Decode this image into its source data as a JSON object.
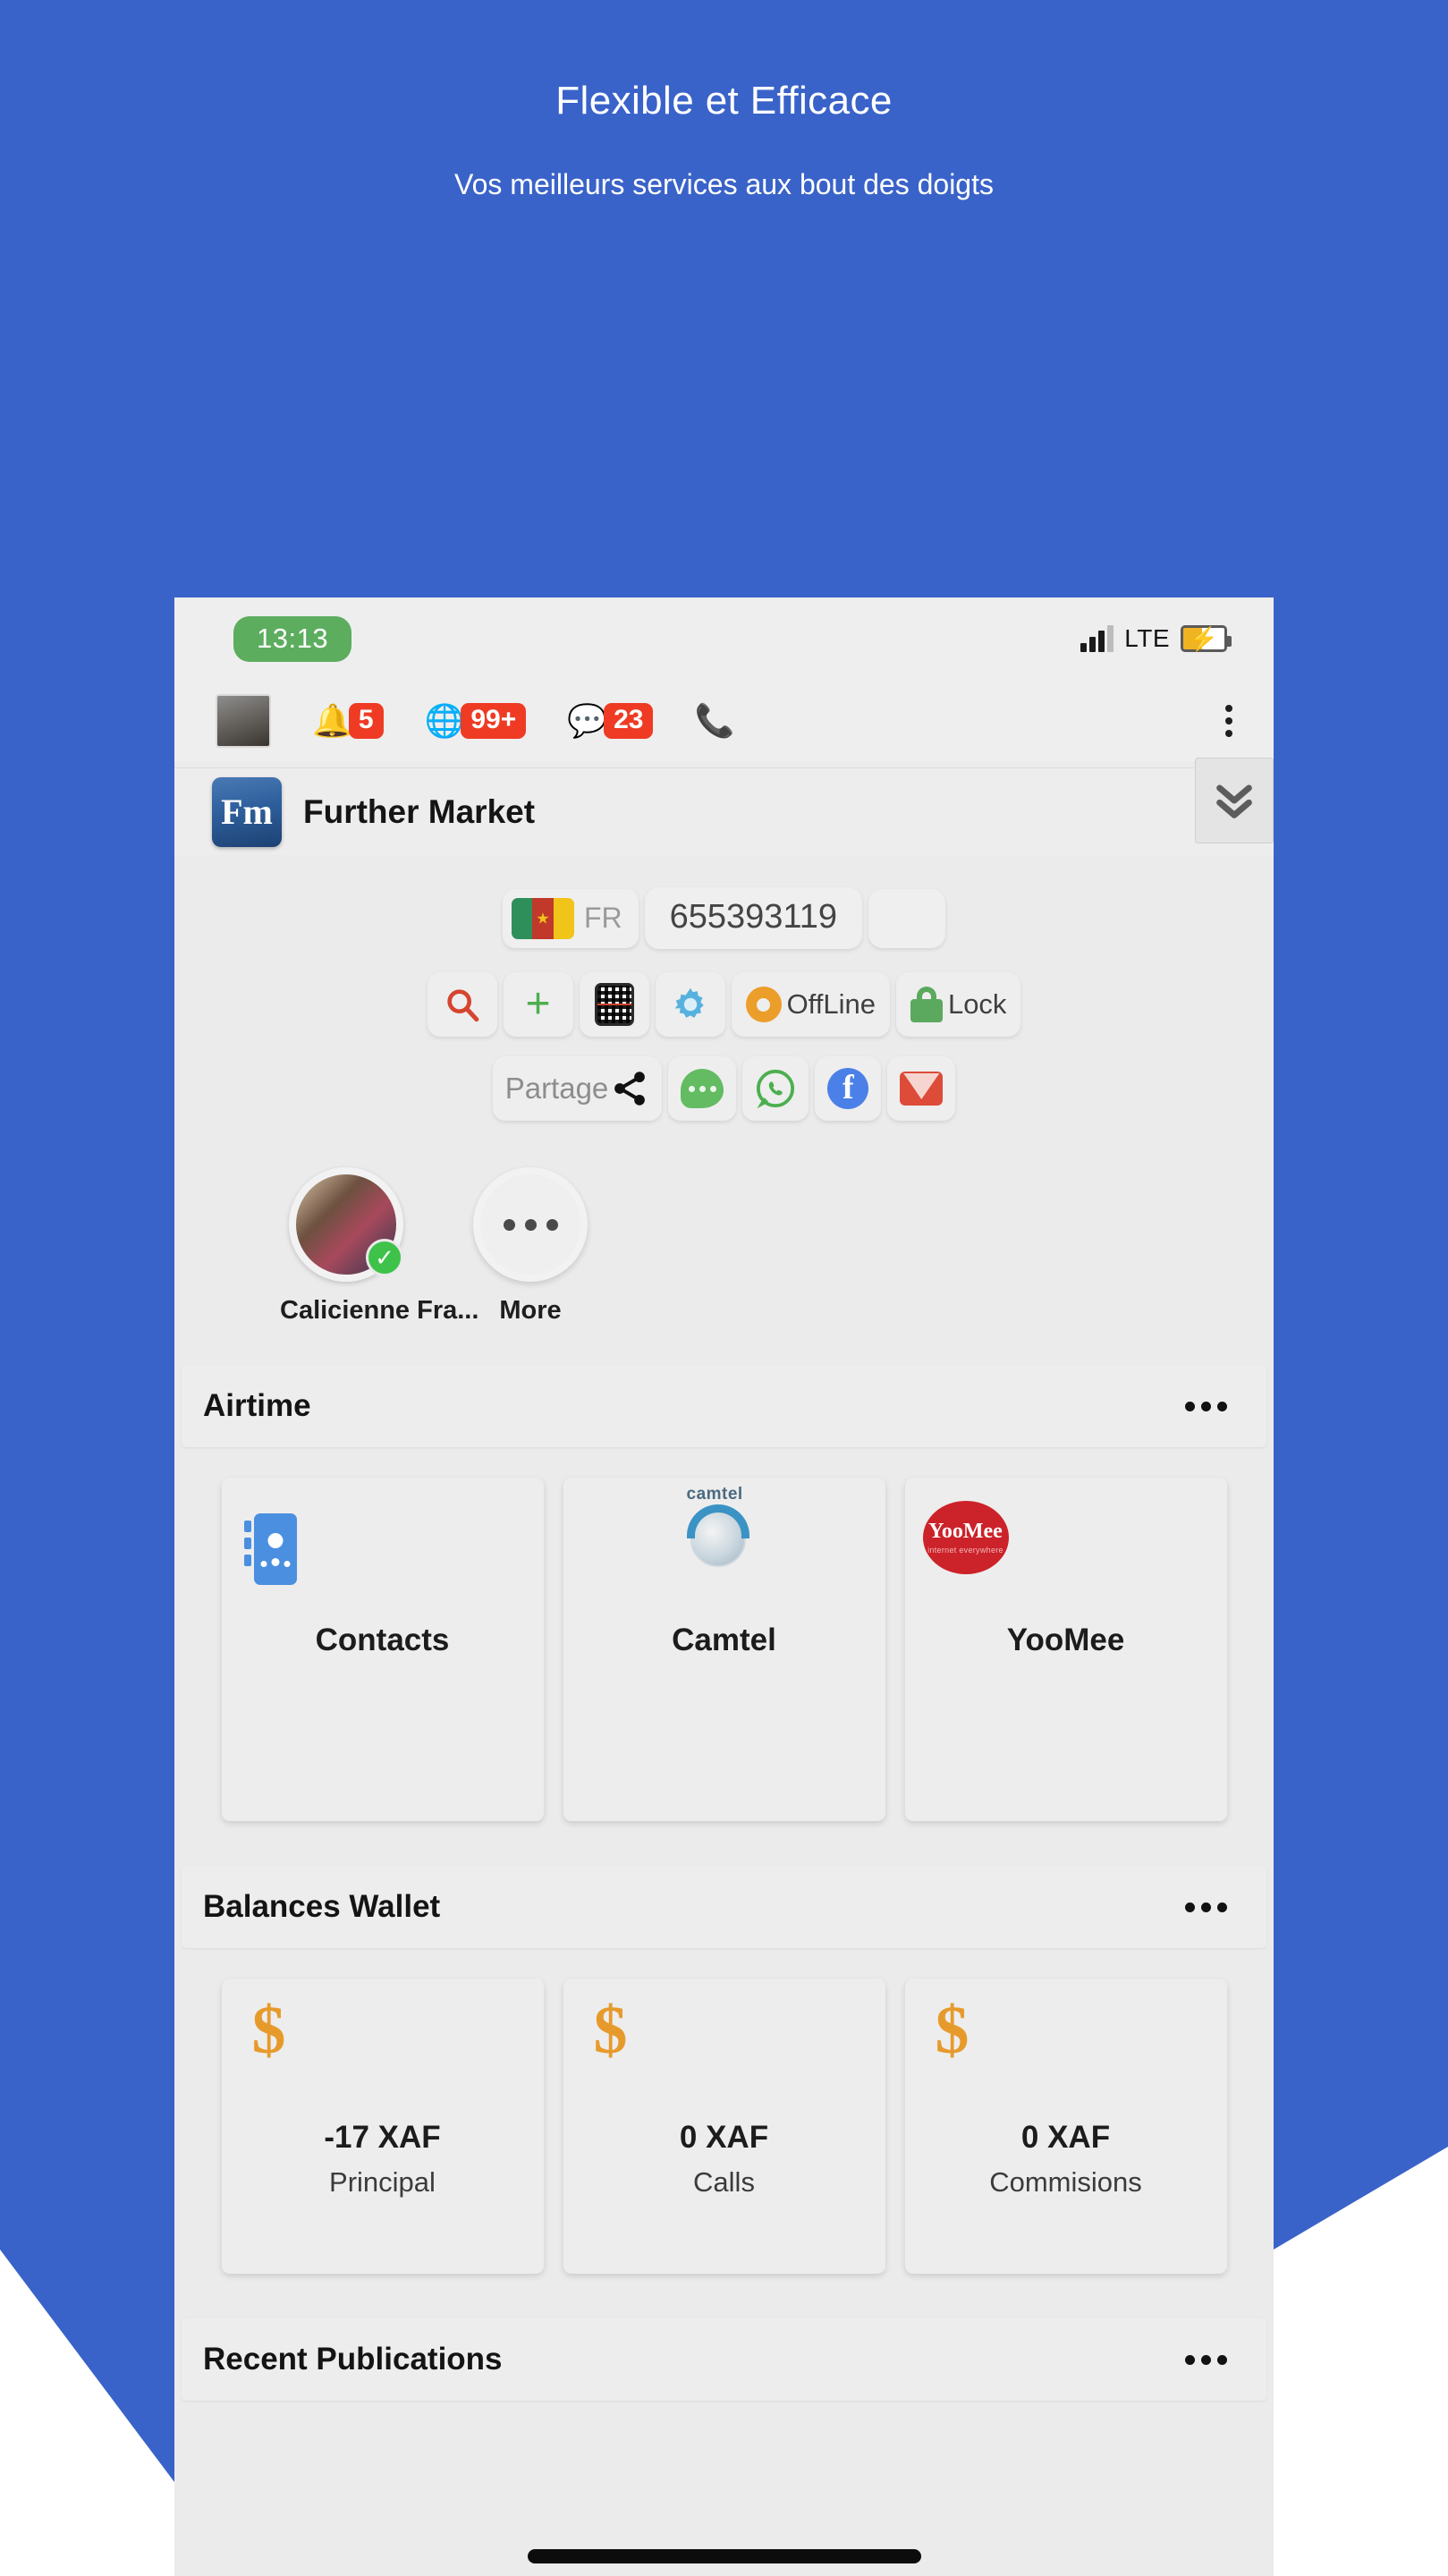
{
  "hero": {
    "title": "Flexible et Efficace",
    "subtitle": "Vos meilleurs services aux bout des doigts",
    "bg_color": "#3a63c9"
  },
  "statusbar": {
    "time": "13:13",
    "network": "LTE",
    "battery_state": "charging",
    "bolt": "⚡",
    "time_pill_color": "#5cad5e"
  },
  "notifications": {
    "avatar_label": "profile-photo",
    "items": [
      {
        "icon": "bell-icon",
        "glyph": "🔔",
        "count": "5"
      },
      {
        "icon": "globe-icon",
        "glyph": "🌐",
        "count": "99+"
      },
      {
        "icon": "chat-bubble-icon",
        "glyph": "💬",
        "count": "23"
      },
      {
        "icon": "phone-icon",
        "glyph": "📞",
        "count": ""
      }
    ],
    "badge_color": "#ef3b24",
    "overflow": "more-options"
  },
  "app_header": {
    "logo_text": "Fm",
    "name": "Further Market",
    "expand_icon": "double-chevron-down-icon"
  },
  "phone_row": {
    "country_code": "FR",
    "flag": "cameroon-flag",
    "number": "655393119",
    "extra_field": ""
  },
  "actions": [
    {
      "name": "search-button",
      "icon": "search-icon",
      "label": ""
    },
    {
      "name": "add-button",
      "icon": "plus-icon",
      "label": ""
    },
    {
      "name": "qr-scan-button",
      "icon": "qr-code-icon",
      "label": ""
    },
    {
      "name": "settings-button",
      "icon": "gear-icon",
      "label": ""
    },
    {
      "name": "offline-toggle",
      "icon": "status-dot-icon",
      "label": "OffLine"
    },
    {
      "name": "lock-button",
      "icon": "lock-icon",
      "label": "Lock"
    }
  ],
  "share": {
    "label": "Partage",
    "targets": [
      {
        "name": "share-sms",
        "icon": "sms-bubble-icon"
      },
      {
        "name": "share-whatsapp",
        "icon": "whatsapp-icon"
      },
      {
        "name": "share-facebook",
        "icon": "facebook-icon"
      },
      {
        "name": "share-email",
        "icon": "email-icon"
      }
    ]
  },
  "contacts": [
    {
      "name": "Calicienne Fra...",
      "verified": true
    },
    {
      "name": "More",
      "verified": false
    }
  ],
  "sections": [
    {
      "title": "Airtime",
      "cards": [
        {
          "label": "Contacts",
          "icon": "contacts-book-icon"
        },
        {
          "label": "Camtel",
          "icon": "camtel-logo"
        },
        {
          "label": "YooMee",
          "icon": "yoomee-logo"
        }
      ]
    },
    {
      "title": "Balances Wallet",
      "balances": [
        {
          "amount": "-17 XAF",
          "label": "Principal",
          "icon": "dollar-icon"
        },
        {
          "amount": "0 XAF",
          "label": "Calls",
          "icon": "dollar-icon"
        },
        {
          "amount": "0 XAF",
          "label": "Commisions",
          "icon": "dollar-icon"
        }
      ]
    },
    {
      "title": "Recent Publications"
    }
  ],
  "brand": {
    "accent_orange": "#e79a2c",
    "accent_green": "#5aa95e",
    "accent_red": "#ef3b24"
  }
}
